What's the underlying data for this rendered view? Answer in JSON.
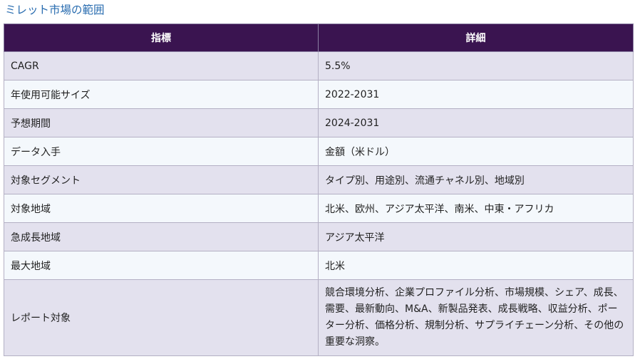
{
  "page": {
    "title": "ミレット市場の範囲"
  },
  "table": {
    "headers": [
      "指標",
      "詳細"
    ],
    "rows": [
      [
        "CAGR",
        "5.5%"
      ],
      [
        "年使用可能サイズ",
        "2022-2031"
      ],
      [
        "予想期間",
        "2024-2031"
      ],
      [
        "データ入手",
        "金額（米ドル）"
      ],
      [
        "対象セグメント",
        "タイプ別、用途別、流通チャネル別、地域別"
      ],
      [
        "対象地域",
        "北米、欧州、アジア太平洋、南米、中東・アフリカ"
      ],
      [
        "急成長地域",
        "アジア太平洋"
      ],
      [
        "最大地域",
        "北米"
      ],
      [
        "レポート対象",
        "競合環境分析、企業プロファイル分析、市場規模、シェア、成長、需要、最新動向、M&A、新製品発表、成長戦略、収益分析、ポーター分析、価格分析、規制分析、サプライチェーン分析、その他の重要な洞察。"
      ]
    ]
  },
  "colors": {
    "title": "#2a6db0",
    "header_bg": "#3a1450",
    "row_odd": "#e3e1ee",
    "row_even": "#f4f8fc"
  }
}
